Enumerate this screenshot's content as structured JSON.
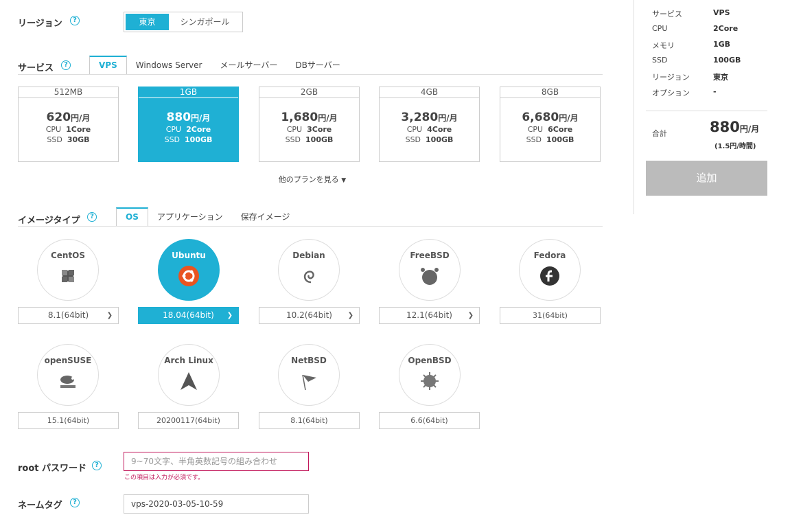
{
  "region": {
    "label": "リージョン",
    "options": [
      "東京",
      "シンガポール"
    ]
  },
  "service": {
    "label": "サービス",
    "tabs": [
      "VPS",
      "Windows Server",
      "メールサーバー",
      "DBサーバー"
    ]
  },
  "plans": [
    {
      "mem": "512MB",
      "price": "620",
      "unit": "円/月",
      "cpu_label": "CPU",
      "cpu": "1Core",
      "ssd_label": "SSD",
      "ssd": "30GB"
    },
    {
      "mem": "1GB",
      "price": "880",
      "unit": "円/月",
      "cpu_label": "CPU",
      "cpu": "2Core",
      "ssd_label": "SSD",
      "ssd": "100GB"
    },
    {
      "mem": "2GB",
      "price": "1,680",
      "unit": "円/月",
      "cpu_label": "CPU",
      "cpu": "3Core",
      "ssd_label": "SSD",
      "ssd": "100GB"
    },
    {
      "mem": "4GB",
      "price": "3,280",
      "unit": "円/月",
      "cpu_label": "CPU",
      "cpu": "4Core",
      "ssd_label": "SSD",
      "ssd": "100GB"
    },
    {
      "mem": "8GB",
      "price": "6,680",
      "unit": "円/月",
      "cpu_label": "CPU",
      "cpu": "6Core",
      "ssd_label": "SSD",
      "ssd": "100GB"
    }
  ],
  "more_plans": "他のプランを見る",
  "image": {
    "label": "イメージタイプ",
    "tabs": [
      "OS",
      "アプリケーション",
      "保存イメージ"
    ]
  },
  "os": [
    {
      "name": "CentOS",
      "version": "8.1(64bit)",
      "icon": "centos-icon"
    },
    {
      "name": "Ubuntu",
      "version": "18.04(64bit)",
      "icon": "ubuntu-icon"
    },
    {
      "name": "Debian",
      "version": "10.2(64bit)",
      "icon": "debian-icon"
    },
    {
      "name": "FreeBSD",
      "version": "12.1(64bit)",
      "icon": "freebsd-icon"
    },
    {
      "name": "Fedora",
      "version": "31(64bit)",
      "icon": "fedora-icon"
    },
    {
      "name": "openSUSE",
      "version": "15.1(64bit)",
      "icon": "opensuse-icon"
    },
    {
      "name": "Arch Linux",
      "version": "20200117(64bit)",
      "icon": "archlinux-icon"
    },
    {
      "name": "NetBSD",
      "version": "8.1(64bit)",
      "icon": "netbsd-icon"
    },
    {
      "name": "OpenBSD",
      "version": "6.6(64bit)",
      "icon": "openbsd-icon"
    }
  ],
  "root_password": {
    "label": "root パスワード",
    "placeholder": "9~70文字、半角英数記号の組み合わせ",
    "error": "この項目は入力が必須です。"
  },
  "name_tag": {
    "label": "ネームタグ",
    "value": "vps-2020-03-05-10-59"
  },
  "summary": {
    "rows": [
      {
        "k": "サービス",
        "v": "VPS"
      },
      {
        "k": "CPU",
        "v": "2Core"
      },
      {
        "k": "メモリ",
        "v": "1GB"
      },
      {
        "k": "SSD",
        "v": "100GB"
      },
      {
        "k": "リージョン",
        "v": "東京"
      },
      {
        "k": "オプション",
        "v": "-"
      }
    ],
    "total_label": "合計",
    "total_price": "880",
    "total_unit": "円/月",
    "hourly": "(1.5円/時間)",
    "add_button": "追加"
  },
  "help_glyph": "?",
  "colors": {
    "accent": "#1fb0d4",
    "error": "#c2185b",
    "disabled": "#bbbbbb"
  }
}
